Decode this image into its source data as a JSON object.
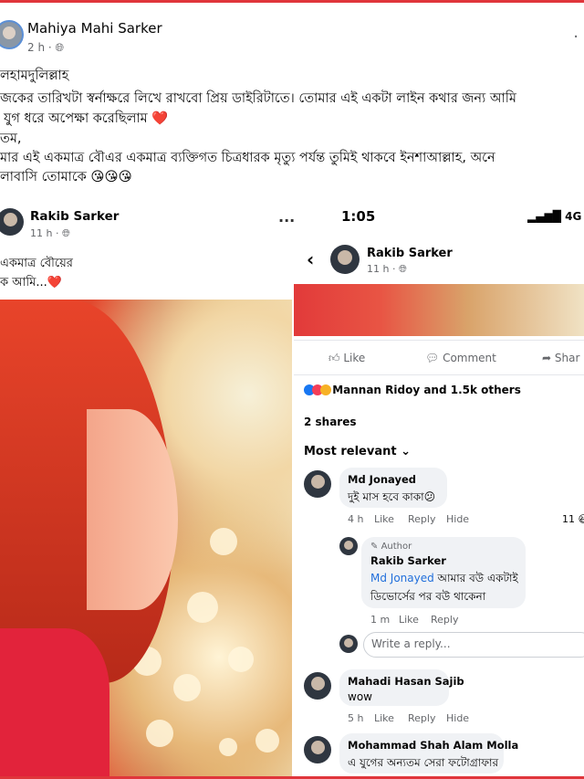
{
  "post": {
    "author": "Mahiya Mahi Sarker",
    "time": "2 h · ",
    "globe_icon": "globe-icon",
    "more": "·",
    "lines": [
      "লহামদুলিল্লাহ",
      "জকের তারিখটা স্বর্নাক্ষরে লিখে রাখবো প্রিয় ডাইরিটাতে। তোমার এই একটা লাইন কথার জন্য আমি",
      "যুগ ধরে অপেক্ষা করেছিলাম ❤️",
      "তম,",
      "মার এই একমাত্র বৌএর একমাত্র ব্যক্তিগত চিত্রধারক মৃত্যু পর্যন্ত তুমিই থাকবে ইনশাআল্লাহ, অনে",
      "লাবাসি তোমাকে 😘😘😘"
    ]
  },
  "shared": {
    "author": "Rakib Sarker",
    "time": "11 h · ",
    "more": "···",
    "caption": [
      "একমাত্র বৌয়ের",
      "ক আমি...❤️"
    ]
  },
  "phone": {
    "status_time": "1:05",
    "status_signal": "4G",
    "back": "‹",
    "author": "Rakib Sarker",
    "time": "11 h · ",
    "actions": {
      "like": "Like",
      "comment": "Comment",
      "share": "Shar"
    },
    "reactions": "Mannan Ridoy and 1.5k others",
    "shares": "2 shares",
    "sort": "Most relevant ⌄",
    "comments": [
      {
        "name": "Md Jonayed",
        "text": "দুই মাস হবে কাকা😕",
        "age": "4 h",
        "like": "Like",
        "reply": "Reply",
        "hide": "Hide",
        "count": "11"
      },
      {
        "badge": "Author",
        "name": "Rakib Sarker",
        "mention": "Md Jonayed",
        "text1": " আমার বউ একটাই",
        "text2": "ডিভোর্সের পর বউ থাকেনা",
        "age": "1 m",
        "like": "Like",
        "reply": "Reply"
      },
      {
        "name": "Mahadi Hasan Sajib",
        "text": "wow",
        "age": "5 h",
        "like": "Like",
        "reply": "Reply",
        "hide": "Hide"
      },
      {
        "name": "Mohammad Shah Alam Molla",
        "text": "এ যুগের অন্যতম সেরা ফটোগ্রাফার"
      }
    ],
    "reply_placeholder": "Write a reply..."
  }
}
